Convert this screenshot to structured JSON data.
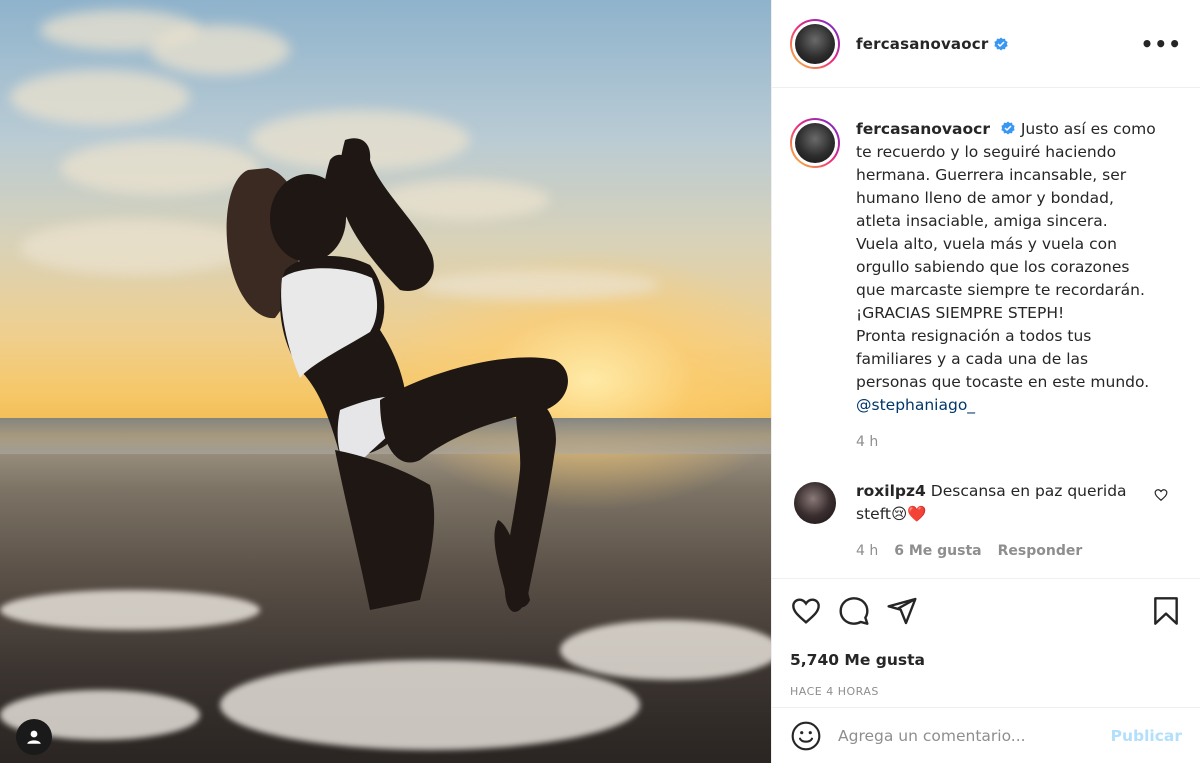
{
  "post": {
    "username": "fercasanovaocr",
    "more_label": "•••"
  },
  "caption": {
    "username": "fercasanovaocr",
    "lines": [
      "Justo así es como",
      "te recuerdo y lo seguiré haciendo",
      "hermana. Guerrera incansable, ser",
      "humano lleno de amor y bondad,",
      "atleta insaciable, amiga sincera.",
      "Vuela alto, vuela más y vuela con",
      "orgullo sabiendo que los corazones",
      "que marcaste siempre te recordarán.",
      "¡GRACIAS SIEMPRE STEPH!",
      "Pronta resignación a todos tus",
      "familiares y a cada una de las",
      "personas que tocaste en este mundo."
    ],
    "mention": "@stephaniago_",
    "time": "4 h"
  },
  "comment": {
    "username": "roxilpz4",
    "text_line1": "Descansa en paz querida",
    "text_line2": "steft😢❤️",
    "time": "4 h",
    "likes": "6 Me gusta",
    "reply": "Responder"
  },
  "actions": {
    "likes_count": "5,740 Me gusta",
    "post_time": "HACE 4 HORAS"
  },
  "add_comment": {
    "placeholder": "Agrega un comentario...",
    "publish_label": "Publicar"
  },
  "colors": {
    "verified": "#3897f0",
    "mention": "#00376b",
    "publish": "#b2dffc",
    "muted": "#8e8e8e"
  }
}
